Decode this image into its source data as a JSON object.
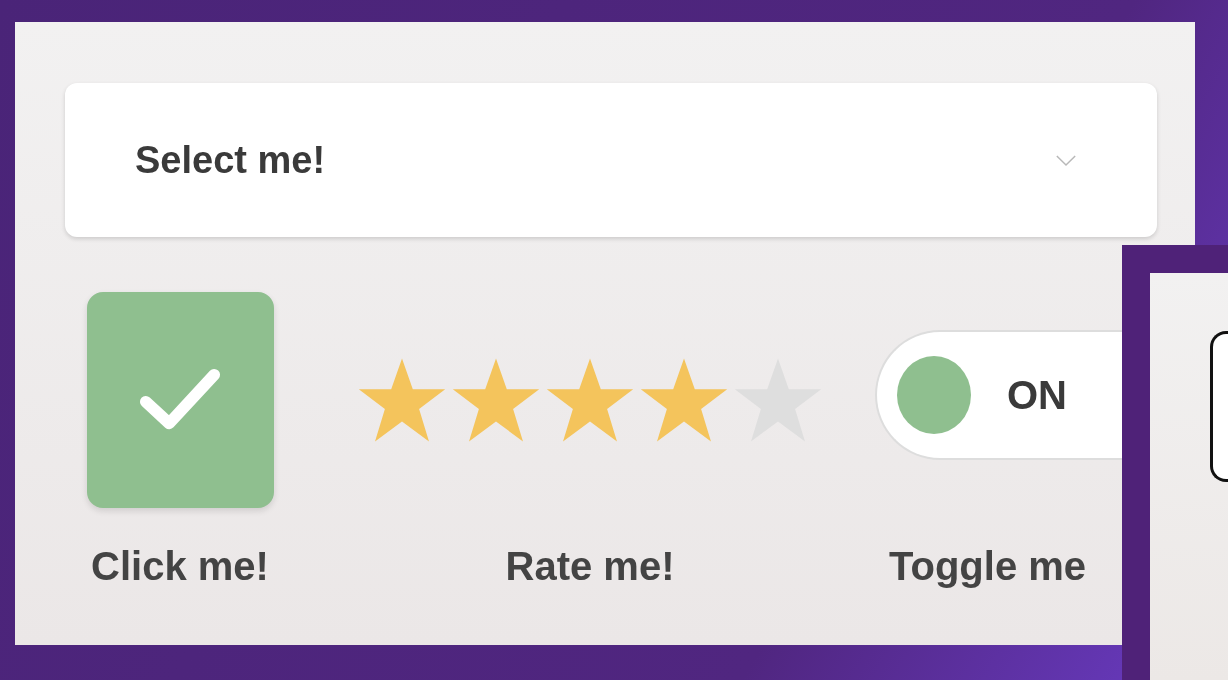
{
  "select": {
    "value": "Select me!"
  },
  "checkbox": {
    "checked": true,
    "label": "Click me!"
  },
  "rating": {
    "stars": 4,
    "label": "Rate me!"
  },
  "toggle": {
    "on": true,
    "text": "ON",
    "label": "Toggle me"
  }
}
